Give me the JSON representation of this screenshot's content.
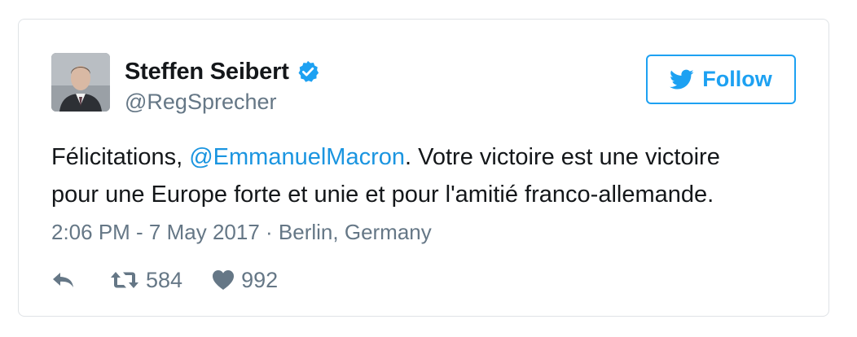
{
  "tweet": {
    "author": {
      "display_name": "Steffen Seibert",
      "handle": "@RegSprecher",
      "verified": true
    },
    "follow_label": "Follow",
    "text_line1_before": "Félicitations, ",
    "mention": "@EmmanuelMacron",
    "text_line1_after": ". Votre victoire est une victoire",
    "text_line2": "pour une Europe forte et unie et pour l'amitié franco-allemande.",
    "timestamp": "2:06 PM - 7 May 2017",
    "separator": " · ",
    "location": "Berlin, Germany",
    "retweet_count": "584",
    "like_count": "992"
  },
  "icons": {
    "verified": "verified-badge-icon",
    "follow": "twitter-bird-icon",
    "reply": "reply-arrow-icon",
    "retweet": "retweet-icon",
    "like": "heart-icon"
  },
  "colors": {
    "accent": "#1da1f2",
    "mention": "#1b95e0",
    "text": "#14171a",
    "secondary": "#657786",
    "border": "#dfe3e6"
  }
}
